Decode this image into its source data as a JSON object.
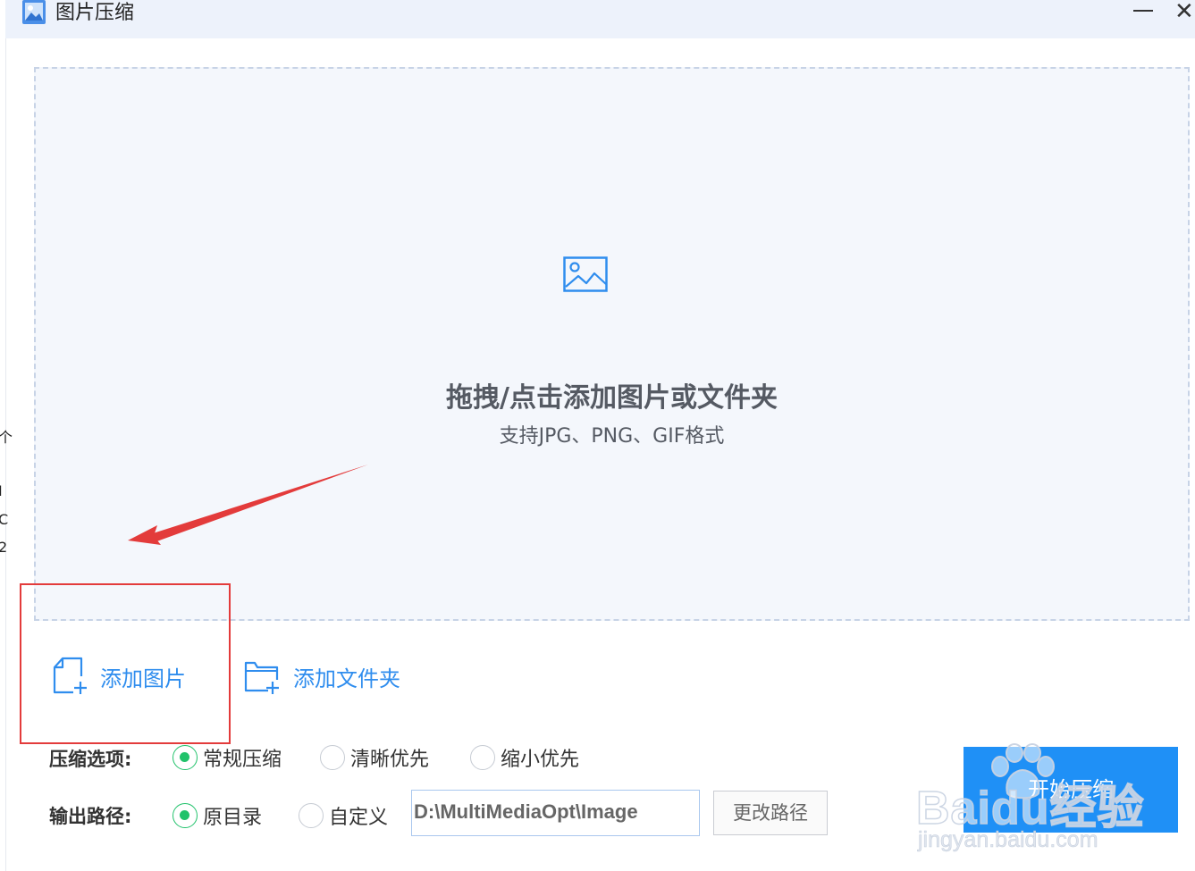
{
  "window": {
    "title": "图片压缩",
    "app_icon": "image-app-icon",
    "minimize_icon": "minimize-icon",
    "close_icon": "close-icon",
    "close_glyph": "✕"
  },
  "left_fragments": [
    "个",
    "I",
    "C",
    "2"
  ],
  "drop_zone": {
    "icon": "image-icon",
    "title": "拖拽/点击添加图片或文件夹",
    "subtitle": "支持JPG、PNG、GIF格式"
  },
  "actions": {
    "add_image_label": "添加图片",
    "add_image_icon": "add-file-icon",
    "add_folder_label": "添加文件夹",
    "add_folder_icon": "add-folder-icon"
  },
  "compress_options": {
    "label": "压缩选项:",
    "options": [
      "常规压缩",
      "清晰优先",
      "缩小优先"
    ],
    "selected": "常规压缩"
  },
  "output_path": {
    "label": "输出路径:",
    "options": [
      "原目录",
      "自定义"
    ],
    "selected": "原目录",
    "path_value": "D:\\MultiMediaOpt\\Image",
    "change_button": "更改路径"
  },
  "start_button": "开始压缩",
  "watermark": {
    "brand": "Baidu经验",
    "url": "jingyan.baidu.com"
  },
  "colors": {
    "accent_blue": "#2f8dee",
    "start_button_bg": "#1f90f6",
    "radio_selected": "#21c26b",
    "annotation_red": "#e33b3b",
    "drop_zone_bg": "#f4f7fc",
    "titlebar_bg": "#edf2fb"
  }
}
